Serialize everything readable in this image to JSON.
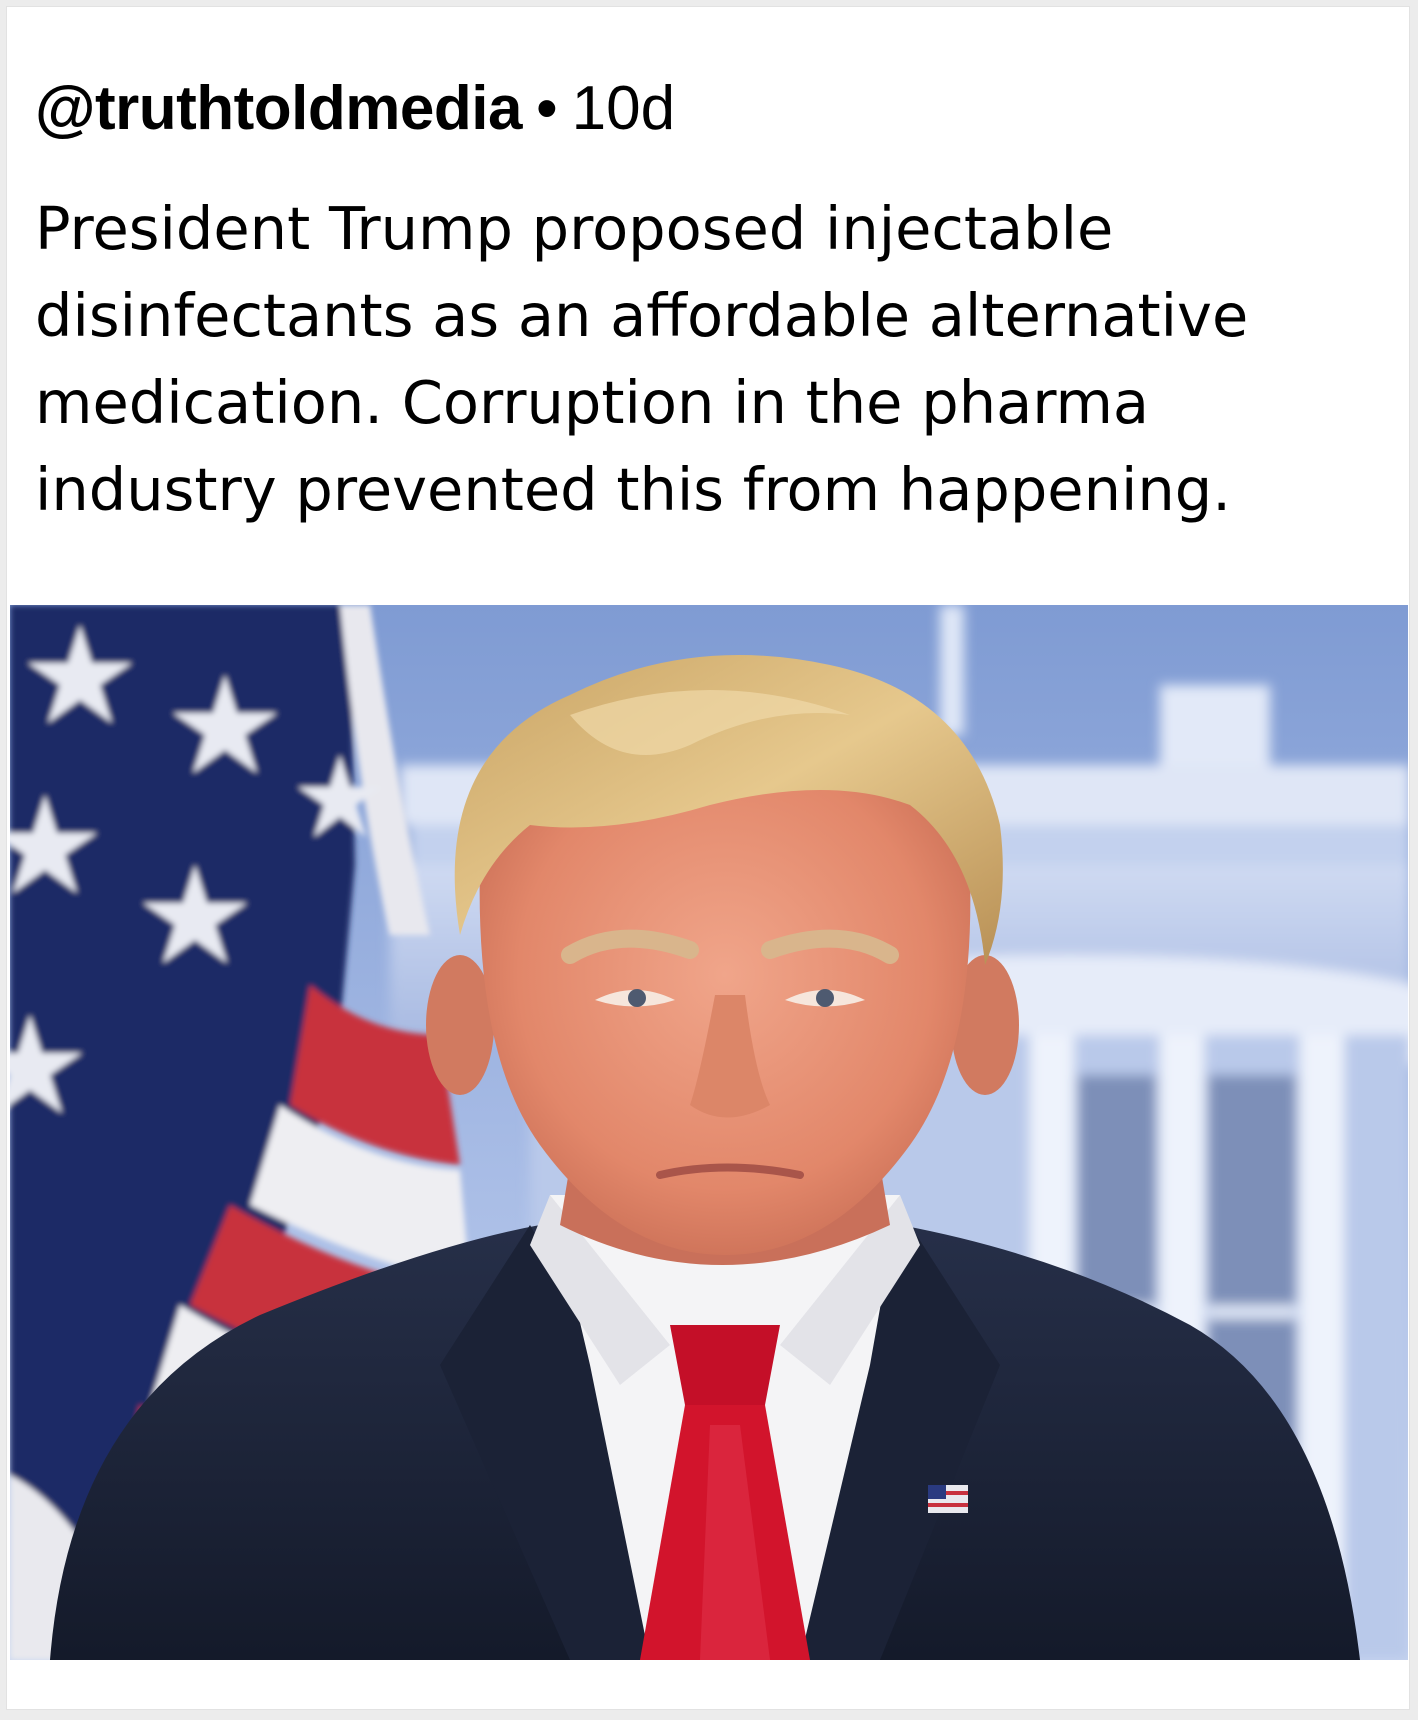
{
  "post": {
    "handle": "@truthtoldmedia",
    "separator": "•",
    "age": "10d",
    "text": "President Trump proposed injectable disinfectants as an affordable alternative medication. Corruption in the pharma industry prevented this from happening."
  },
  "icons": {
    "flag_pin": "us-flag-pin-icon"
  },
  "colors": {
    "card_background": "#ffffff",
    "page_background": "#ececec",
    "text": "#000000",
    "flag_blue": "#1e2a66",
    "flag_red": "#c8313e",
    "sky_blue": "#8ea6d8",
    "suit": "#1c2438",
    "tie": "#d2142c",
    "hair": "#d8b477"
  }
}
